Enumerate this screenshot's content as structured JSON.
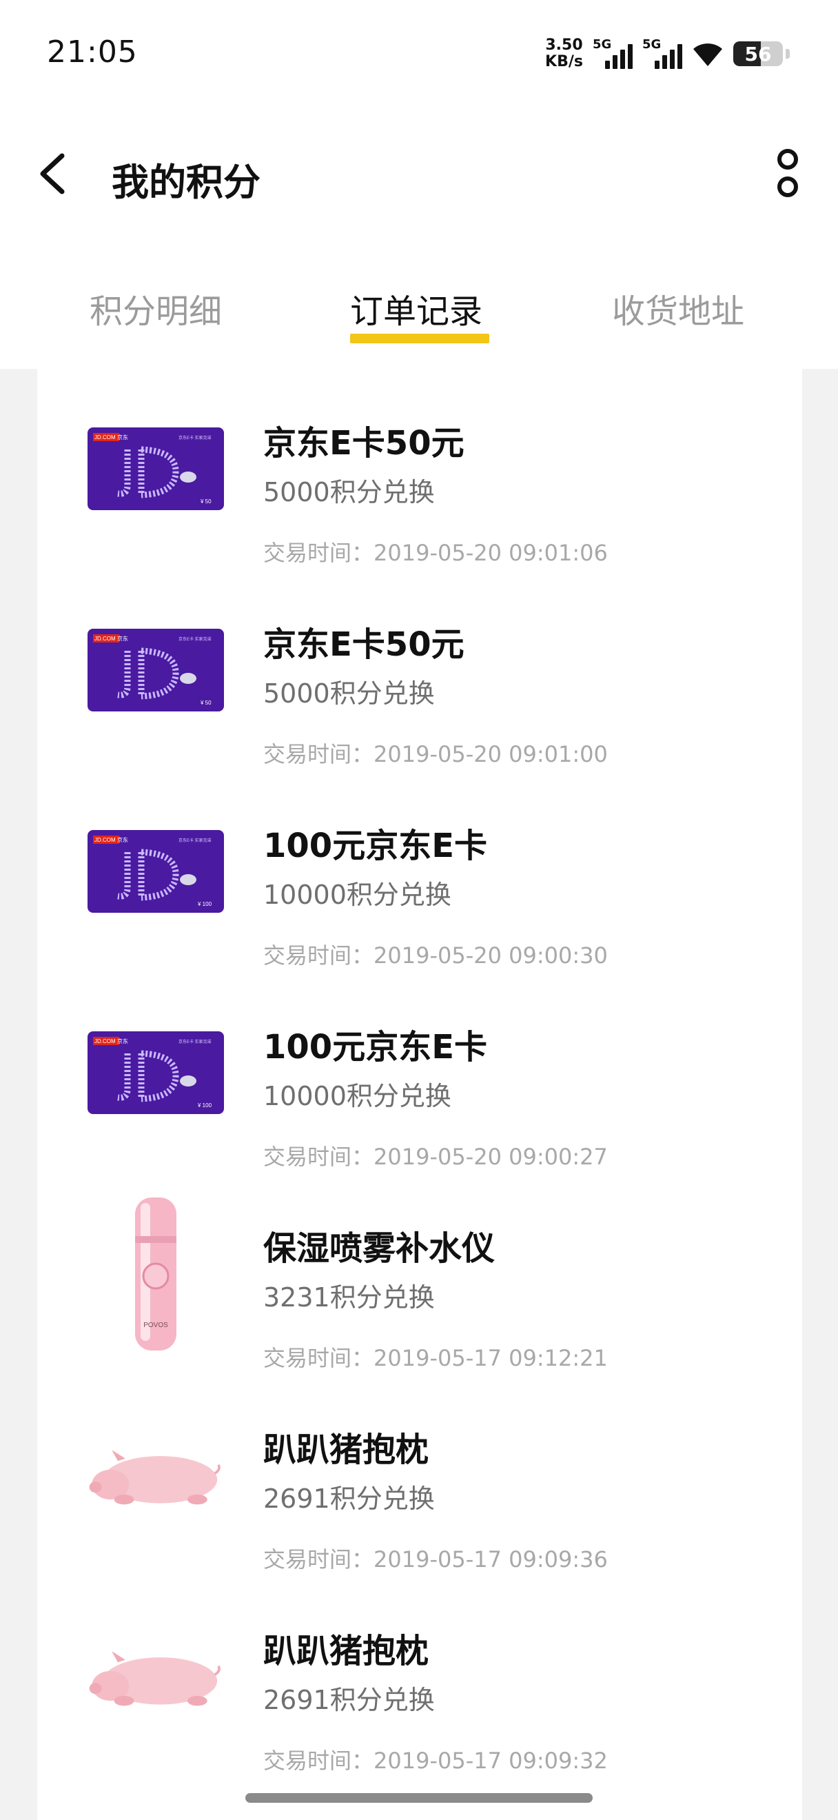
{
  "status_bar": {
    "time": "21:05",
    "net_speed_value": "3.50",
    "net_speed_unit": "KB/s",
    "signal1_label": "5G",
    "signal2_label": "5G",
    "battery_level": "56"
  },
  "nav": {
    "title": "我的积分"
  },
  "tabs": [
    {
      "label": "积分明细",
      "active": false
    },
    {
      "label": "订单记录",
      "active": true
    },
    {
      "label": "收货地址",
      "active": false
    }
  ],
  "colors": {
    "accent": "#f3c516",
    "card_purple": "#4a1aa0",
    "jd_red": "#e1251b"
  },
  "orders": [
    {
      "name": "京东E卡50元",
      "points": "5000积分兑换",
      "time": "交易时间：2019-05-20 09:01:06",
      "thumb": "jd-card",
      "card_brand": "JD.COM 京东",
      "card_slogan": "京东E卡 实家克诺",
      "card_value": "¥ 50"
    },
    {
      "name": "京东E卡50元",
      "points": "5000积分兑换",
      "time": "交易时间：2019-05-20 09:01:00",
      "thumb": "jd-card",
      "card_brand": "JD.COM 京东",
      "card_slogan": "京东E卡 实家克诺",
      "card_value": "¥ 50"
    },
    {
      "name": "100元京东E卡",
      "points": "10000积分兑换",
      "time": "交易时间：2019-05-20 09:00:30",
      "thumb": "jd-card",
      "card_brand": "JD.COM 京东",
      "card_slogan": "京东E卡 实家克诺",
      "card_value": "¥ 100"
    },
    {
      "name": "100元京东E卡",
      "points": "10000积分兑换",
      "time": "交易时间：2019-05-20 09:00:27",
      "thumb": "jd-card",
      "card_brand": "JD.COM 京东",
      "card_slogan": "京东E卡 实家克诺",
      "card_value": "¥ 100"
    },
    {
      "name": "保湿喷雾补水仪",
      "points": "3231积分兑换",
      "time": "交易时间：2019-05-17 09:12:21",
      "thumb": "sprayer",
      "product_brand": "POVOS"
    },
    {
      "name": "趴趴猪抱枕",
      "points": "2691积分兑换",
      "time": "交易时间：2019-05-17 09:09:36",
      "thumb": "pig-pillow"
    },
    {
      "name": "趴趴猪抱枕",
      "points": "2691积分兑换",
      "time": "交易时间：2019-05-17 09:09:32",
      "thumb": "pig-pillow"
    }
  ]
}
